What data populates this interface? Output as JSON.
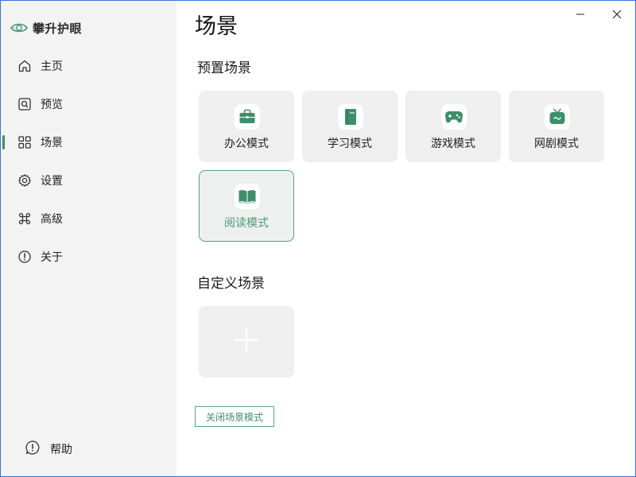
{
  "app": {
    "title": "攀升护眼"
  },
  "sidebar": {
    "items": [
      {
        "label": "主页",
        "icon": "home-icon"
      },
      {
        "label": "预览",
        "icon": "preview-icon"
      },
      {
        "label": "场景",
        "icon": "grid-icon",
        "active": true
      },
      {
        "label": "设置",
        "icon": "gear-icon"
      },
      {
        "label": "高级",
        "icon": "command-icon"
      },
      {
        "label": "关于",
        "icon": "info-icon"
      }
    ],
    "help": {
      "label": "帮助",
      "icon": "help-icon"
    }
  },
  "main": {
    "title": "场景",
    "preset_section": {
      "title": "预置场景",
      "cards": [
        {
          "label": "办公模式",
          "icon": "briefcase-icon"
        },
        {
          "label": "学习模式",
          "icon": "book-icon"
        },
        {
          "label": "游戏模式",
          "icon": "gamepad-icon"
        },
        {
          "label": "网剧模式",
          "icon": "tv-icon"
        },
        {
          "label": "阅读模式",
          "icon": "open-book-icon",
          "selected": true
        }
      ]
    },
    "custom_section": {
      "title": "自定义场景",
      "add_icon": "plus-icon"
    },
    "close_mode_button": "关闭场景模式"
  },
  "colors": {
    "accent": "#3e8e6c",
    "accent_light": "#5da184",
    "sidebar_bg": "#f3f3f3",
    "card_bg": "#efefef"
  }
}
